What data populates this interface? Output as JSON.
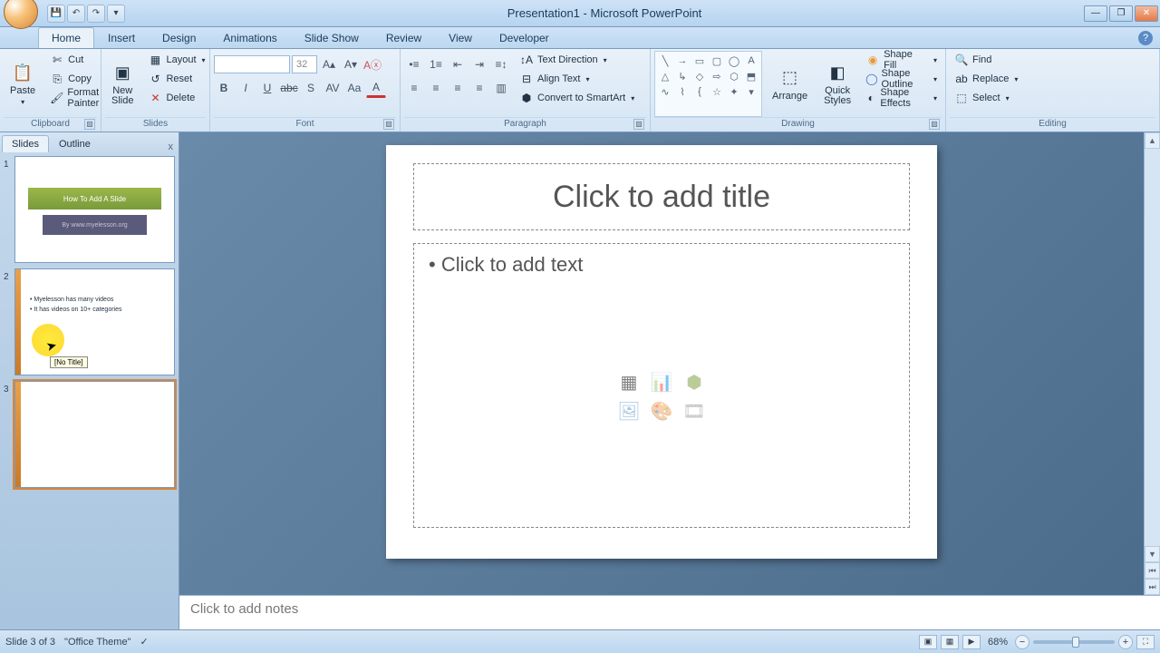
{
  "title": "Presentation1 - Microsoft PowerPoint",
  "qat": {
    "save": "💾",
    "undo": "↶",
    "redo": "↷",
    "more": "▾"
  },
  "window_controls": {
    "min": "—",
    "max": "❐",
    "close": "✕"
  },
  "tabs": [
    "Home",
    "Insert",
    "Design",
    "Animations",
    "Slide Show",
    "Review",
    "View",
    "Developer"
  ],
  "active_tab": "Home",
  "ribbon": {
    "clipboard": {
      "label": "Clipboard",
      "paste": "Paste",
      "cut": "Cut",
      "copy": "Copy",
      "format_painter": "Format Painter"
    },
    "slides": {
      "label": "Slides",
      "new_slide": "New\nSlide",
      "layout": "Layout",
      "reset": "Reset",
      "delete": "Delete"
    },
    "font": {
      "label": "Font",
      "size": "32"
    },
    "paragraph": {
      "label": "Paragraph",
      "text_direction": "Text Direction",
      "align_text": "Align Text",
      "convert": "Convert to SmartArt"
    },
    "drawing": {
      "label": "Drawing",
      "arrange": "Arrange",
      "quick_styles": "Quick\nStyles",
      "shape_fill": "Shape Fill",
      "shape_outline": "Shape Outline",
      "shape_effects": "Shape Effects"
    },
    "editing": {
      "label": "Editing",
      "find": "Find",
      "replace": "Replace",
      "select": "Select"
    }
  },
  "panel": {
    "slides_tab": "Slides",
    "outline_tab": "Outline",
    "close": "x"
  },
  "thumbs": {
    "t1": {
      "num": "1",
      "title": "How To Add A Slide",
      "sub": "By www.myelesson.org"
    },
    "t2": {
      "num": "2",
      "b1": "Myelesson has many videos",
      "b2": "It has videos on 10+ categories",
      "tooltip": "[No Title]"
    },
    "t3": {
      "num": "3"
    }
  },
  "slide": {
    "title_placeholder": "Click to add title",
    "body_placeholder": "Click to add text"
  },
  "notes": {
    "placeholder": "Click to add notes"
  },
  "status": {
    "slide": "Slide 3 of 3",
    "theme": "\"Office Theme\"",
    "zoom": "68%"
  }
}
